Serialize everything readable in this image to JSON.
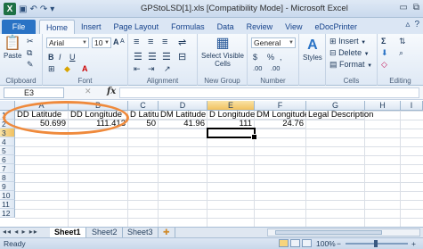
{
  "window": {
    "title": "GPStoLSD[1].xls  [Compatibility Mode]  -  Microsoft Excel",
    "minimize": "▭",
    "restore": "⧉",
    "close": "✕"
  },
  "ribbon_tabs": {
    "file": "File",
    "items": [
      "Home",
      "Insert",
      "Page Layout",
      "Formulas",
      "Data",
      "Review",
      "View",
      "eDocPrinter"
    ]
  },
  "ribbon": {
    "clipboard": {
      "label": "Clipboard",
      "paste": "Paste"
    },
    "font": {
      "label": "Font",
      "name": "Arial",
      "size": "10",
      "bold": "B",
      "italic": "I",
      "underline": "U",
      "grow": "A",
      "shrink": "A"
    },
    "alignment": {
      "label": "Alignment"
    },
    "new_group": {
      "label": "New Group",
      "select_visible": "Select Visible Cells"
    },
    "number": {
      "label": "Number",
      "format": "General",
      "currency": "$",
      "percent": "%",
      "comma": ",",
      "inc_dec": ".00"
    },
    "styles": {
      "label": "Styles"
    },
    "cells": {
      "label": "Cells",
      "insert": "Insert",
      "delete": "Delete",
      "format": "Format"
    },
    "editing": {
      "label": "Editing",
      "sum": "Σ"
    }
  },
  "formula_bar": {
    "name_box": "E3",
    "fx": "fx",
    "cancel": "✕",
    "content": ""
  },
  "grid": {
    "columns": [
      "A",
      "B",
      "C",
      "D",
      "E",
      "F",
      "G",
      "H",
      "I"
    ],
    "selected_column": "E",
    "rows": [
      "1",
      "2",
      "3",
      "4",
      "5",
      "6",
      "7",
      "8",
      "9",
      "10",
      "11",
      "12"
    ],
    "selected_row": "3",
    "headers": [
      "DD Latitude",
      "DD Longitude",
      "D Latitude",
      "DM Latitude",
      "D Longitude",
      "DM Longitude",
      "Legal Description"
    ],
    "row2": [
      "50.699",
      "111.413",
      "50",
      "41.96",
      "111",
      "24.76",
      ""
    ]
  },
  "sheet_tabs": {
    "nav": "◂◂ ◂ ▸ ▸▸",
    "tabs": [
      "Sheet1",
      "Sheet2",
      "Sheet3"
    ],
    "active": "Sheet1"
  },
  "status_bar": {
    "status": "Ready",
    "zoom": "100%",
    "minus": "−",
    "plus": "+"
  },
  "colors": {
    "highlight_oval": "#ef8a3c",
    "excel_green": "#1e7145",
    "file_tab": "#2a73c5"
  }
}
